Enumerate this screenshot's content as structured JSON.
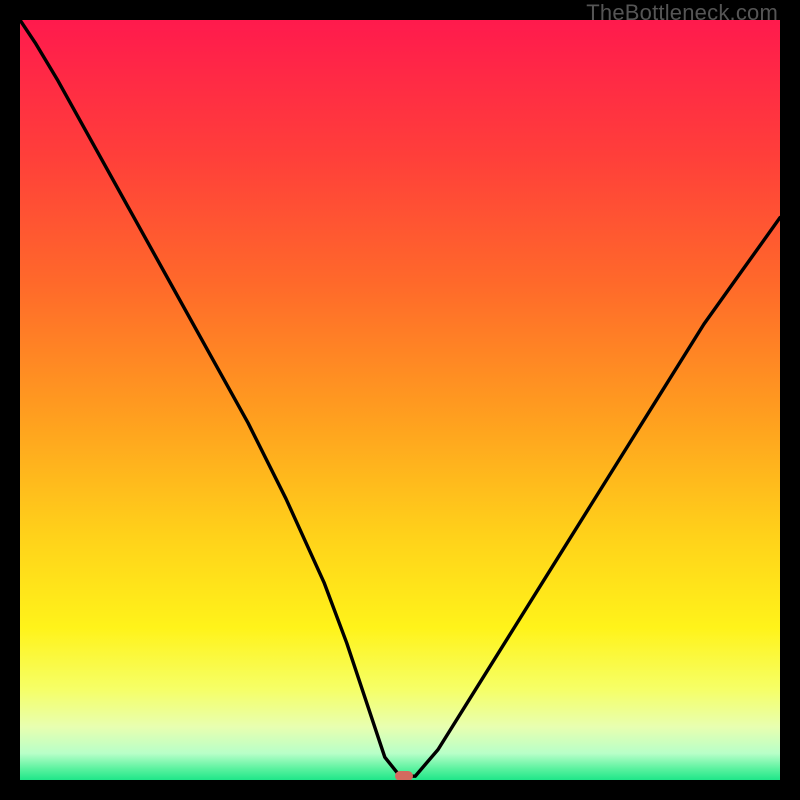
{
  "watermark": "TheBottleneck.com",
  "chart_data": {
    "type": "line",
    "title": "",
    "xlabel": "",
    "ylabel": "",
    "xlim": [
      0,
      100
    ],
    "ylim": [
      0,
      100
    ],
    "series": [
      {
        "name": "curve",
        "x": [
          0,
          2,
          5,
          10,
          15,
          20,
          25,
          30,
          35,
          40,
          43,
          46,
          48,
          50,
          52,
          55,
          60,
          65,
          70,
          75,
          80,
          85,
          90,
          95,
          100
        ],
        "y": [
          100,
          97,
          92,
          83,
          74,
          65,
          56,
          47,
          37,
          26,
          18,
          9,
          3,
          0.5,
          0.5,
          4,
          12,
          20,
          28,
          36,
          44,
          52,
          60,
          67,
          74
        ]
      }
    ],
    "marker": {
      "x": 50.5,
      "y": 0.5
    },
    "gradient_stops": [
      {
        "offset": 0,
        "color": "#ff1a4d"
      },
      {
        "offset": 0.18,
        "color": "#ff3f3a"
      },
      {
        "offset": 0.35,
        "color": "#ff6a2a"
      },
      {
        "offset": 0.52,
        "color": "#ff9e1f"
      },
      {
        "offset": 0.68,
        "color": "#ffd21a"
      },
      {
        "offset": 0.8,
        "color": "#fff31a"
      },
      {
        "offset": 0.88,
        "color": "#f6ff66"
      },
      {
        "offset": 0.93,
        "color": "#e8ffb0"
      },
      {
        "offset": 0.965,
        "color": "#b8ffc8"
      },
      {
        "offset": 0.985,
        "color": "#5cf2a0"
      },
      {
        "offset": 1.0,
        "color": "#1fe689"
      }
    ]
  }
}
